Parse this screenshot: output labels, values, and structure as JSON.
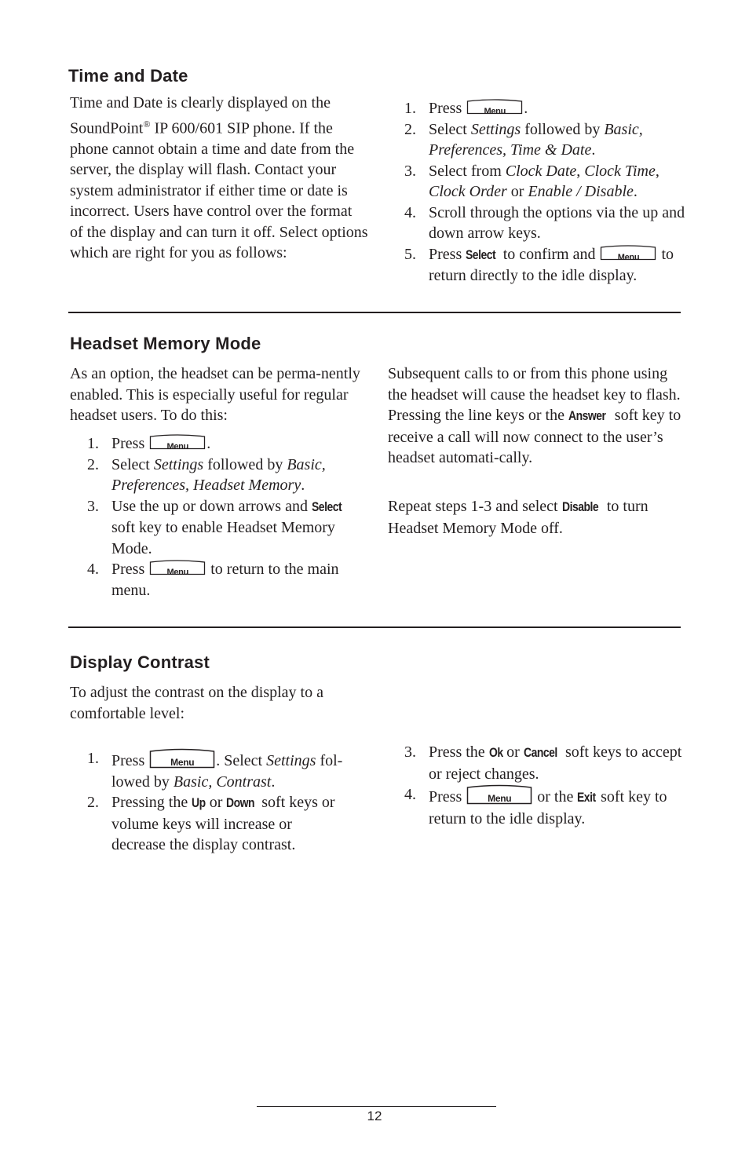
{
  "sections": {
    "time_date": {
      "title": "Time and Date",
      "intro_a": "Time and Date is clearly displayed on the SoundPoint",
      "reg": "®",
      "intro_b": " IP 600/601 SIP phone.  If the phone cannot obtain a time and date from the server, the display will flash.  Contact your system administrator if either time or date is incorrect.  Users have control over the format of the display and can turn it off.  Select options which are right for you as follows:",
      "steps": [
        {
          "num": "1.",
          "t1": "Press ",
          "t2": "."
        },
        {
          "num": "2.",
          "t1": "Select ",
          "i1": "Settings",
          "t2": " followed by ",
          "i2": "Basic, Preferences, Time & Date",
          "t3": "."
        },
        {
          "num": "3.",
          "t1": "Select from ",
          "i1": "Clock Date",
          "t2": ", ",
          "i2": "Clock Time",
          "t3": ", ",
          "i3": "Clock Order",
          "t4": " or ",
          "i4": "Enable / Disable",
          "t5": "."
        },
        {
          "num": "4.",
          "t1": "Scroll through the options via the up and down arrow keys."
        },
        {
          "num": "5.",
          "t1": "Press ",
          "k1": "Select",
          "t2": " to confirm and ",
          "t3": " to return directly to the idle display."
        }
      ]
    },
    "headset": {
      "title": "Headset Memory Mode",
      "intro": "As an option, the headset can be perma-nently enabled.  This is especially useful for regular headset users.  To do this:",
      "steps": [
        {
          "num": "1.",
          "t1": "Press ",
          "t2": "."
        },
        {
          "num": "2.",
          "t1": "Select ",
          "i1": "Settings",
          "t2": " followed by ",
          "i2": "Basic, Preferences, Headset Memory",
          "t3": "."
        },
        {
          "num": "3.",
          "t1": "Use the up or down arrows and ",
          "k1": "Select",
          "t2": " soft key to enable Headset Memory Mode."
        },
        {
          "num": "4.",
          "t1": "Press ",
          "t2": " to return to the main menu."
        }
      ],
      "right_p1_a": "Subsequent calls to or from this phone using the headset will cause the headset key to flash.  Pressing the line keys or the ",
      "right_p1_k": "Answer",
      "right_p1_b": " soft key to receive a call will now connect to the user’s headset automati-cally.",
      "right_p2_a": "Repeat steps 1-3 and select ",
      "right_p2_k": "Disable",
      "right_p2_b": " to turn Headset Memory Mode off."
    },
    "contrast": {
      "title": "Display Contrast",
      "intro": "To adjust the contrast on the display to a comfortable level:",
      "steps": [
        {
          "num": "1.",
          "t1": "Press ",
          "t2": ".  Select ",
          "i1": "Settings",
          "t3": " fol-lowed by ",
          "i2": "Basic, Contrast",
          "t4": "."
        },
        {
          "num": "2.",
          "t1": "Pressing the ",
          "k1": "Up",
          "t2": " or ",
          "k2": "Down",
          "t3": " soft keys or volume keys will increase or decrease the display contrast."
        },
        {
          "num": "3.",
          "t1": "Press the ",
          "k1": "Ok",
          "t2": " or ",
          "k2": "Cancel",
          "t3": " soft keys to accept or reject changes."
        },
        {
          "num": "4.",
          "t1": "Press ",
          "t2": " or the ",
          "k1": "Exit",
          "t3": " soft key to return to the idle display."
        }
      ]
    }
  },
  "menu_key_label": "Menu",
  "footer": {
    "page_number": "12"
  }
}
